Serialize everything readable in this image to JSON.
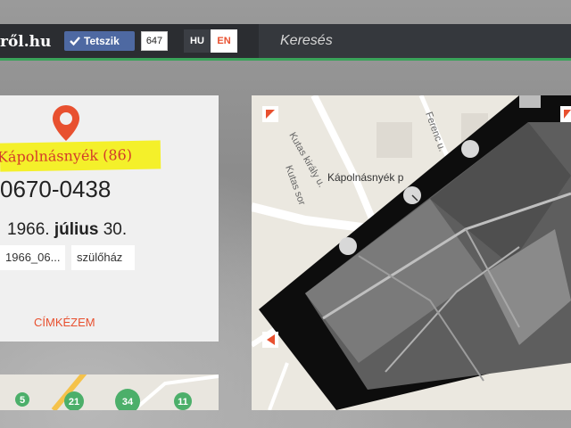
{
  "header": {
    "logo": "ről.hu",
    "like_label": "Tetszik",
    "like_count": "647",
    "lang_hu": "HU",
    "lang_en": "EN",
    "search_label": "Keresés"
  },
  "photo": {
    "place": "Kápolnásnyék (86)",
    "id": "0670-0438",
    "date_year": "1966.",
    "date_month": "július",
    "date_day": "30.",
    "tags": [
      "1966_06...",
      "szülőház"
    ],
    "tag_action": "CÍMKÉZEM"
  },
  "mini_map": {
    "markers": [
      "5",
      "21",
      "34",
      "11"
    ]
  },
  "map": {
    "town_label": "Kápolnásnyék p",
    "streets": [
      "Kutas király u.",
      "Kutas sor",
      "Ferenc u."
    ]
  },
  "colors": {
    "accent": "#e8502f",
    "highlight": "#f4f02a",
    "facebook": "#4e69a2",
    "bar": "#2b2d31",
    "green_line": "#3aa35a"
  }
}
